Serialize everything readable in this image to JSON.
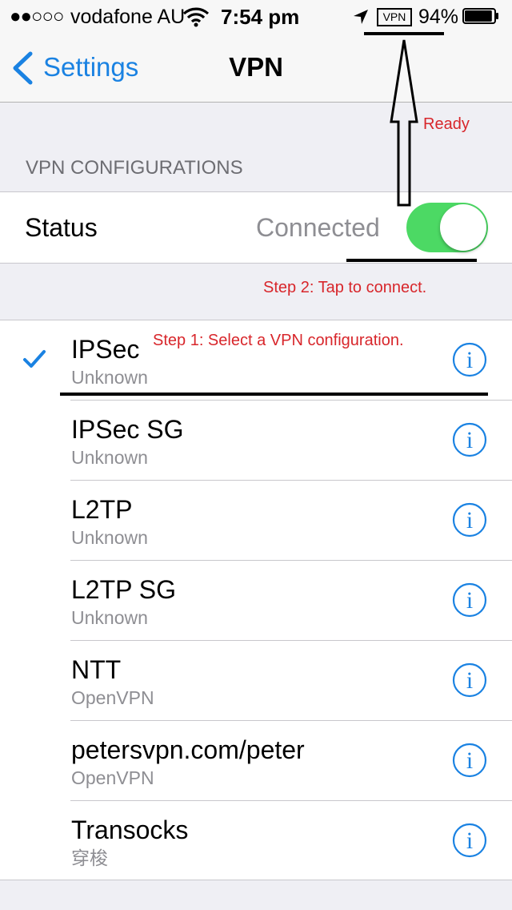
{
  "status_bar": {
    "signal": "●●○○○",
    "carrier": "vodafone AU",
    "wifi_icon": "wifi-icon",
    "time": "7:54 pm",
    "location_icon": "location-arrow-icon",
    "vpn_badge": "VPN",
    "battery_percent": "94%",
    "battery_icon": "battery-icon",
    "battery_level": 0.94
  },
  "nav": {
    "back_label": "Settings",
    "title": "VPN"
  },
  "section": {
    "header": "VPN CONFIGURATIONS"
  },
  "status_row": {
    "label": "Status",
    "value": "Connected",
    "toggle_on": true
  },
  "configurations": [
    {
      "name": "IPSec",
      "detail": "Unknown",
      "selected": true
    },
    {
      "name": "IPSec SG",
      "detail": "Unknown",
      "selected": false
    },
    {
      "name": "L2TP",
      "detail": "Unknown",
      "selected": false
    },
    {
      "name": "L2TP SG",
      "detail": "Unknown",
      "selected": false
    },
    {
      "name": "NTT",
      "detail": "OpenVPN",
      "selected": false
    },
    {
      "name": "petersvpn.com/peter",
      "detail": "OpenVPN",
      "selected": false
    },
    {
      "name": "Transocks",
      "detail": "穿梭",
      "selected": false
    }
  ],
  "annotations": {
    "ready": "Ready",
    "step2": "Step 2: Tap to connect.",
    "step1": "Step 1: Select a VPN configuration."
  },
  "colors": {
    "accent_blue": "#1a82e2",
    "toggle_green": "#4cd964",
    "annotation_red": "#d8262b",
    "background": "#efeff4"
  }
}
